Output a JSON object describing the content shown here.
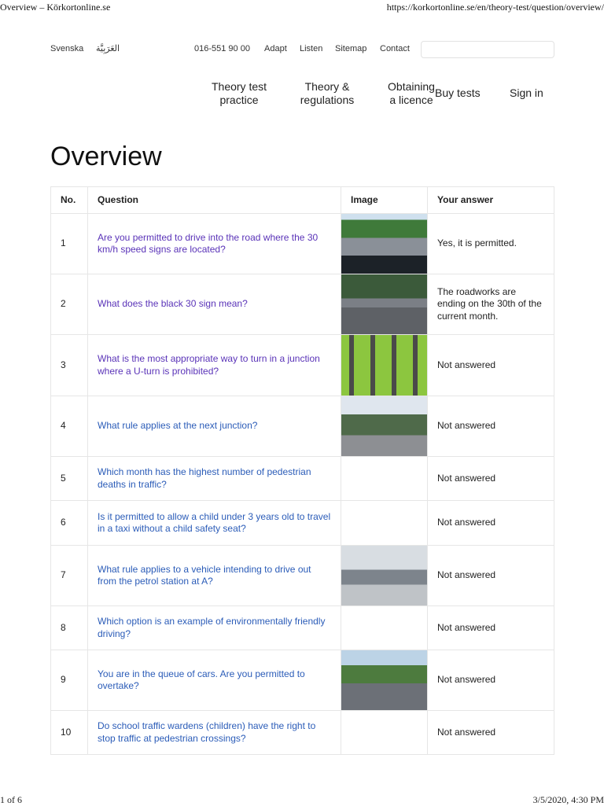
{
  "browser": {
    "title": "Overview – Körkortonline.se",
    "url": "https://korkortonline.se/en/theory-test/question/overview/",
    "page": "1 of 6",
    "datetime": "3/5/2020, 4:30 PM"
  },
  "topbar": {
    "lang1": "Svenska",
    "lang2": "العَرَبِيَّة",
    "phone": "016-551 90 00",
    "adapt": "Adapt",
    "listen": "Listen",
    "sitemap": "Sitemap",
    "contact": "Contact",
    "search_placeholder": ""
  },
  "nav": {
    "theory_test_1": "Theory test",
    "theory_test_2": "practice",
    "theory_reg_1": "Theory &",
    "theory_reg_2": "regulations",
    "licence_1": "Obtaining",
    "licence_2": "a licence",
    "buy": "Buy tests",
    "signin": "Sign in"
  },
  "page_title": "Overview",
  "table": {
    "headers": [
      "No.",
      "Question",
      "Image",
      "Your answer"
    ],
    "rows": [
      {
        "no": "1",
        "q": "Are you permitted to drive into the road where the 30 km/h speed signs are located?",
        "a": "Yes, it is permitted."
      },
      {
        "no": "2",
        "q": "What does the black 30 sign mean?",
        "a": "The roadworks are ending on the 30th of the current month."
      },
      {
        "no": "3",
        "q": "What is the most appropriate way to turn in a junction where a U-turn is prohibited?",
        "a": "Not answered"
      },
      {
        "no": "4",
        "q": "What rule applies at the next junction?",
        "a": "Not answered"
      },
      {
        "no": "5",
        "q": "Which month has the highest number of pedestrian deaths in traffic?",
        "a": "Not answered"
      },
      {
        "no": "6",
        "q": "Is it permitted to allow a child under 3 years old to travel in a taxi without a child safety seat?",
        "a": "Not answered"
      },
      {
        "no": "7",
        "q": "What rule applies to a vehicle intending to drive out from the petrol station at A?",
        "a": "Not answered"
      },
      {
        "no": "8",
        "q": "Which option is an example of environmentally friendly driving?",
        "a": "Not answered"
      },
      {
        "no": "9",
        "q": "You are in the queue of cars. Are you permitted to overtake?",
        "a": "Not answered"
      },
      {
        "no": "10",
        "q": "Do school traffic wardens (children) have the right to stop traffic at pedestrian crossings?",
        "a": "Not answered"
      }
    ]
  }
}
